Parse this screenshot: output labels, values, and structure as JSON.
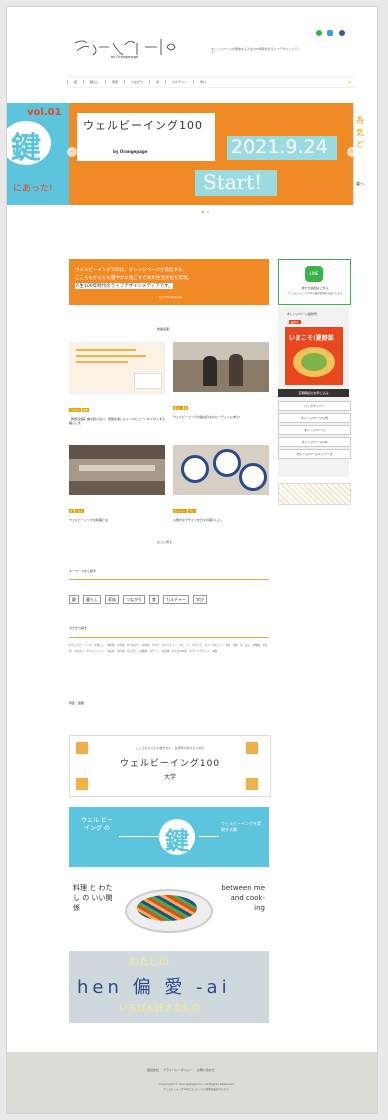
{
  "header": {
    "logo_text": "ウェルビーイング100",
    "logo_sub": "by Orangepage",
    "description": "オレンジページが発信する人生100年時代のライフデザインメディア"
  },
  "social": [
    {
      "icon": "line-icon",
      "color": "#3bb34a"
    },
    {
      "icon": "twitter-icon",
      "color": "#3a9be6"
    },
    {
      "icon": "facebook-icon",
      "color": "#3b5998"
    }
  ],
  "nav": {
    "items": [
      "鍵",
      "暮らし",
      "家族",
      "つながり",
      "食",
      "カルチャー",
      "学び"
    ],
    "search_icon": "search-icon"
  },
  "hero": {
    "left_vol": "vol.01",
    "left_key": "鍵",
    "left_caption": "にあった!",
    "main_logo": "ウェルビーイング100",
    "main_logo_sub": "by Orangepage",
    "date": "2021.9.24",
    "start": "Start!",
    "right_text_1": "為",
    "right_text_2": "気",
    "right_text_3": "ど",
    "right_caption": "楽へ"
  },
  "intro": {
    "line1": "ウェルビーイング100は、オレンジページが発信する、",
    "line2": "こころもからだも健やかに過ごすための生活文化を実現。",
    "line3": "人生100年時代のライフデザインメディアです。",
    "sub": "by Orangepage"
  },
  "line_box": {
    "badge": "LINE",
    "title": "友だち追加はこちら",
    "sub": "ウェルビーイング100の最新情報をお届けします"
  },
  "sections": {
    "new_articles": "新着記事",
    "more": "もっと見る",
    "keyword_title": "キーワードから探す",
    "tag_title": "タグから探す",
    "special_title": "特集・連載"
  },
  "cards": [
    {
      "tags": [
        "つながり",
        "家族"
      ],
      "date": "2021.09.24",
      "title": "【特別企画】誰も知らない、家族を楽しむインタビュー！わくわくする暮らしを"
    },
    {
      "tags": [
        "暮らし",
        "鍵"
      ],
      "date": "2021.09.24",
      "title": "ウェルビーイングの鍵は日々のルーティンにあり!"
    },
    {
      "tags": [
        "食",
        "ごはん"
      ],
      "date": "2021.09.24",
      "title": "ウェルビーイングな料理とは"
    },
    {
      "tags": [
        "カルチャー",
        "学び"
      ],
      "date": "2021.09.24",
      "title": "心豊かなデザインを日々の暮らしに。"
    }
  ],
  "sidebar": {
    "magazine_title": "オレンジページ最新号",
    "magazine_badge": "最新号",
    "cover_text": "いまこそ!夏野菜",
    "buttons": [
      "定期購読のお申し込み",
      "バックナンバー",
      "オレンジページ公式",
      "オレンジページ",
      "オレンジページnet",
      "オレンジページメンバーズ"
    ]
  },
  "keywords": [
    "鍵",
    "暮らし",
    "家族",
    "つながり",
    "食",
    "カルチャー",
    "学び"
  ],
  "tags": [
    "#ウェルビーイング",
    "#暮らし",
    "#料理",
    "#家族",
    "#つながり",
    "#健康",
    "#学び",
    "#カルチャー",
    "#こころ",
    "#からだ",
    "#インタビュー",
    "#食",
    "#旅",
    "#ごはん",
    "#睡眠",
    "#お金",
    "#住まい",
    "#ファッション",
    "#美容",
    "#仕事",
    "#子育て",
    "#趣味",
    "#アート",
    "#読書",
    "#人生100年",
    "#ライフデザイン",
    "#鍵"
  ],
  "banners": {
    "univ_small": "こころもからだも健やかに、生涯学び続けるための",
    "univ_title": "ウェルビーイング100",
    "univ_sub": "大学",
    "key_left": "ウェル ビーイング の",
    "key_center": "鍵",
    "key_right": "ウェルビーイングを実現する鍵",
    "cook_left": "料理 と わたし の いい関係",
    "cook_right": "between me and cook- ing",
    "hen_text": "hen 偏 愛 -ai",
    "hen_overlay_top": "わたしの",
    "hen_overlay_bottom": "いちばん好きなもの"
  },
  "footer": {
    "links": [
      "運営会社",
      "プライバシーポリシー",
      "お問い合わせ"
    ],
    "copyright": "Copyright © Orangepage Inc. All Rights Reserved.",
    "note": "ウェルビーイング100のコンテンツの無断転載を禁じます。"
  }
}
